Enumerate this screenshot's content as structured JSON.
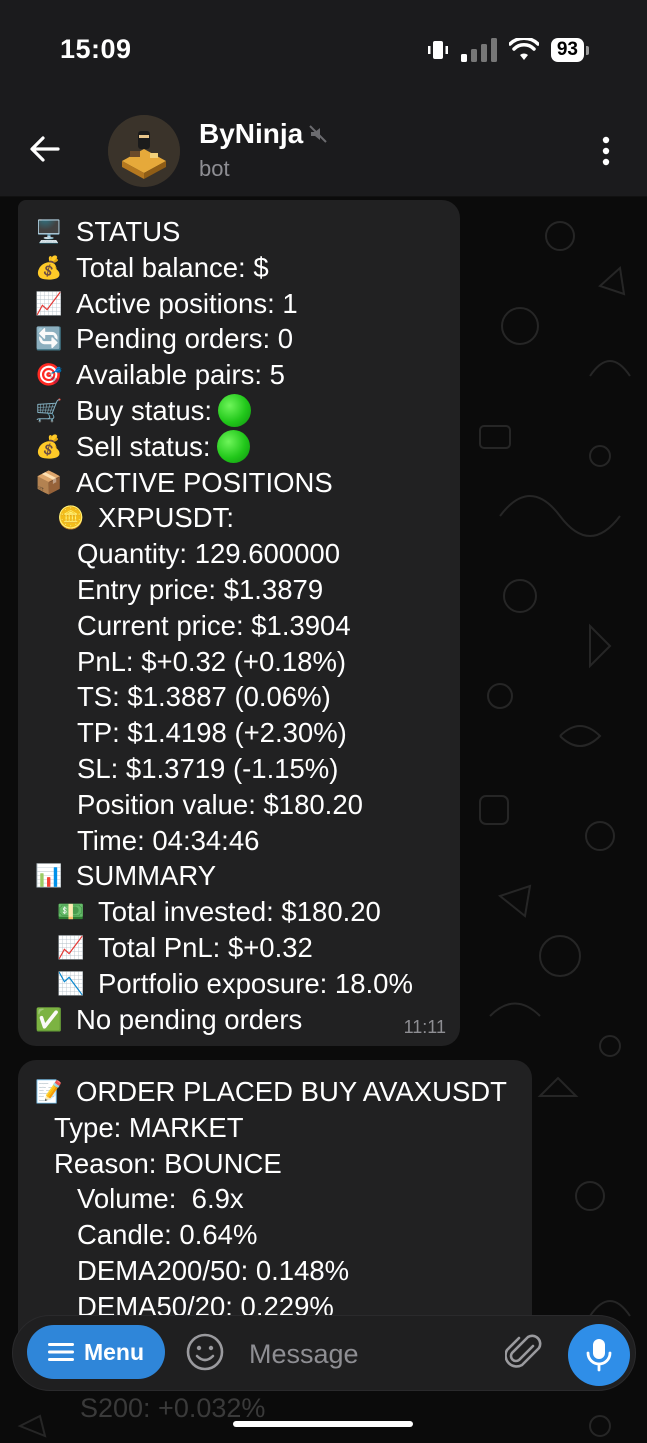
{
  "status_bar": {
    "time": "15:09",
    "battery": "93"
  },
  "header": {
    "title": "ByNinja",
    "subtitle": "bot"
  },
  "messages": [
    {
      "time": "11:11",
      "lines": [
        {
          "emoji": "🖥️",
          "text": "STATUS"
        },
        {
          "emoji": "💰",
          "text": "Total balance: $"
        },
        {
          "emoji": "📈",
          "text": "Active positions: 1"
        },
        {
          "emoji": "🔄",
          "text": "Pending orders: 0"
        },
        {
          "emoji": "🎯",
          "text": "Available pairs: 5"
        },
        {
          "emoji": "🛒",
          "text": "Buy status:"
        },
        {
          "emoji": "💰",
          "text": "Sell status:"
        },
        {
          "emoji": "📦",
          "text": "ACTIVE POSITIONS"
        },
        {
          "emoji": "🪙",
          "text": "XRPUSDT:"
        },
        {
          "text": "Quantity: 129.600000"
        },
        {
          "text": "Entry price: $1.3879"
        },
        {
          "text": "Current price: $1.3904"
        },
        {
          "text": "PnL: $+0.32 (+0.18%)"
        },
        {
          "text": "TS: $1.3887 (0.06%)"
        },
        {
          "text": "TP: $1.4198 (+2.30%)"
        },
        {
          "text": "SL: $1.3719 (-1.15%)"
        },
        {
          "text": "Position value: $180.20"
        },
        {
          "text": "Time: 04:34:46"
        },
        {
          "emoji": "📊",
          "text": "SUMMARY"
        },
        {
          "emoji": "💵",
          "text": "Total invested: $180.20"
        },
        {
          "emoji": "📈",
          "text": "Total PnL: $+0.32"
        },
        {
          "emoji": "📉",
          "text": "Portfolio exposure: 18.0%"
        },
        {
          "emoji": "✅",
          "text": "No pending orders"
        }
      ]
    },
    {
      "lines": [
        {
          "emoji": "📝",
          "text": "ORDER PLACED BUY AVAXUSDT"
        },
        {
          "text": "Type: MARKET"
        },
        {
          "text": "Reason: BOUNCE"
        },
        {
          "text": "Volume:  6.9x"
        },
        {
          "text": "Candle: 0.64%"
        },
        {
          "text": "DEMA200/50: 0.148%"
        },
        {
          "text": "DEMA50/20: 0.229%"
        }
      ]
    }
  ],
  "input": {
    "menu_label": "Menu",
    "placeholder": "Message"
  },
  "below_text": "S200: +0.032%",
  "colors": {
    "accent": "#2f86d9",
    "bubble": "#212122",
    "status_dot": "#21c71a"
  }
}
